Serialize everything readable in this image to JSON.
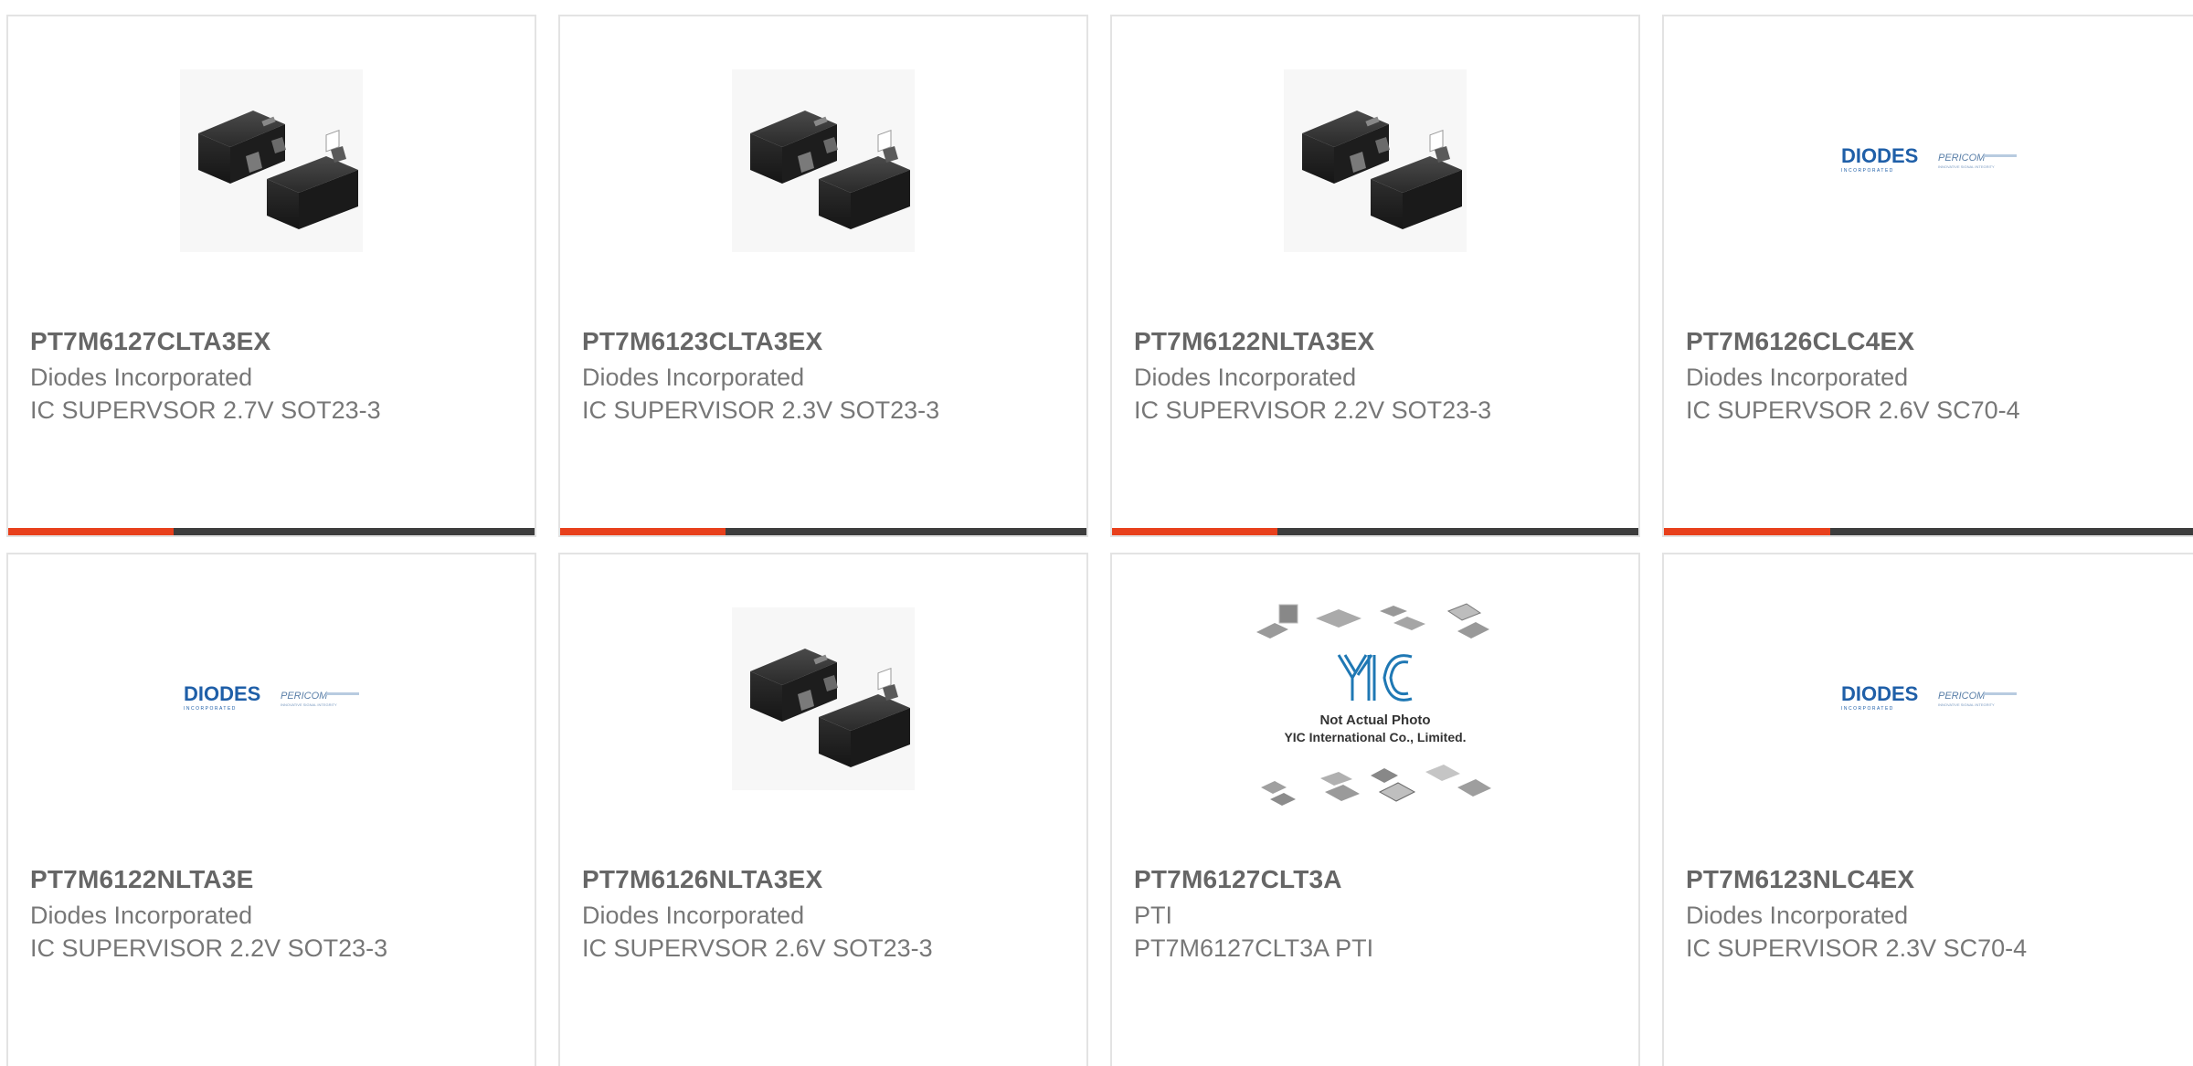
{
  "colors": {
    "accent": "#e8401c",
    "bar_dark": "#3d3d3d",
    "part_number_text": "#666666",
    "body_text": "#777777",
    "card_border": "#e3e3e3",
    "diodes_blue": "#1f5fa8",
    "yic_blue": "#1f78b4"
  },
  "cards": [
    {
      "part_number": "PT7M6127CLTA3EX",
      "manufacturer": "Diodes Incorporated",
      "description": "IC SUPERVSOR 2.7V SOT23-3",
      "image": "sot23-package-image",
      "accent_fraction": 0.31
    },
    {
      "part_number": "PT7M6123CLTA3EX",
      "manufacturer": "Diodes Incorporated",
      "description": "IC SUPERVISOR 2.3V SOT23-3",
      "image": "sot23-package-image",
      "accent_fraction": 0.31
    },
    {
      "part_number": "PT7M6122NLTA3EX",
      "manufacturer": "Diodes Incorporated",
      "description": "IC SUPERVISOR 2.2V SOT23-3",
      "image": "sot23-package-image",
      "accent_fraction": 0.31
    },
    {
      "part_number": "PT7M6126CLC4EX",
      "manufacturer": "Diodes Incorporated",
      "description": "IC SUPERVSOR 2.6V SC70-4",
      "image": "diodes-pericom-logo",
      "accent_fraction": 0.31
    },
    {
      "part_number": "PT7M6122NLTA3E",
      "manufacturer": "Diodes Incorporated",
      "description": "IC SUPERVISOR 2.2V SOT23-3",
      "image": "diodes-pericom-logo"
    },
    {
      "part_number": "PT7M6126NLTA3EX",
      "manufacturer": "Diodes Incorporated",
      "description": "IC SUPERVSOR 2.6V SOT23-3",
      "image": "sot23-package-image"
    },
    {
      "part_number": "PT7M6127CLT3A",
      "manufacturer": "PTI",
      "description": "PT7M6127CLT3A PTI",
      "image": "yic-placeholder-image",
      "image_caption_line1": "Not Actual Photo",
      "image_caption_line2": "YIC International Co., Limited."
    },
    {
      "part_number": "PT7M6123NLC4EX",
      "manufacturer": "Diodes Incorporated",
      "description": "IC SUPERVISOR 2.3V SC70-4",
      "image": "diodes-pericom-logo"
    }
  ],
  "logo": {
    "diodes_word": "DIODES",
    "diodes_sub": "INCORPORATED",
    "pericom_word": "PERICOM",
    "pericom_sub": "INNOVATIVE SIGNAL INTEGRITY"
  }
}
